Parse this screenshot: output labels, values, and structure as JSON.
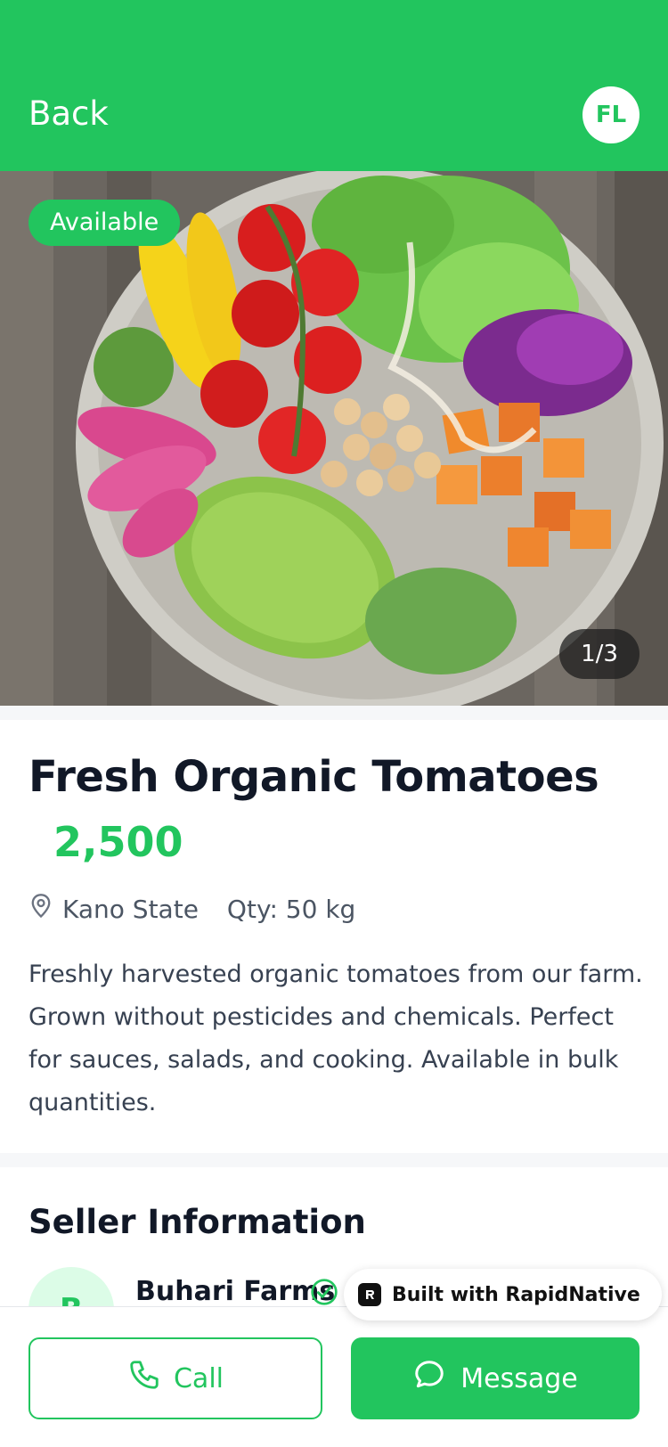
{
  "header": {
    "back_label": "Back",
    "avatar_initials": "FL"
  },
  "hero": {
    "badge": "Available",
    "counter": "1/3"
  },
  "product": {
    "title": "Fresh Organic Tomatoes",
    "price": "2,500",
    "location": "Kano State",
    "quantity": "Qty: 50 kg",
    "description": "Freshly harvested organic tomatoes from our farm. Grown without pesticides and chemicals. Perfect for sauces, salads, and cooking. Available in bulk quantities."
  },
  "seller": {
    "heading": "Seller Information",
    "avatar_letter": "B",
    "name": "Buhari Farms"
  },
  "built_with": {
    "label": "Built with RapidNative"
  },
  "actions": {
    "call_label": "Call",
    "message_label": "Message"
  },
  "colors": {
    "brand": "#22c55e",
    "text_dark": "#111827",
    "text_muted": "#4b5563"
  },
  "icons": {
    "location": "map-pin-icon",
    "verified": "check-circle-icon",
    "call": "phone-icon",
    "message": "chat-bubble-icon"
  }
}
